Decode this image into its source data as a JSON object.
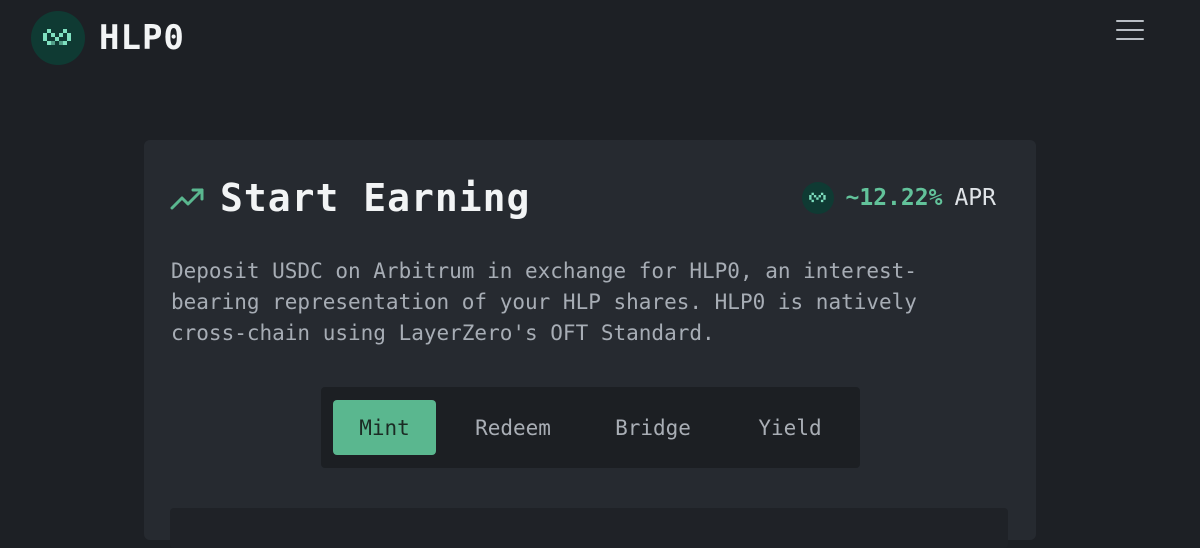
{
  "header": {
    "brand_name": "HLP0",
    "logo_icon": "hlp0-logo-icon",
    "menu_icon": "hamburger-menu-icon"
  },
  "card": {
    "title": "Start Earning",
    "title_icon": "trending-up-icon",
    "apr": {
      "value": "~12.22%",
      "label": "APR",
      "icon": "hlp0-logo-icon"
    },
    "description": "Deposit USDC on Arbitrum in exchange for HLP0, an interest-bearing representation of your HLP shares. HLP0 is natively cross-chain using LayerZero's OFT Standard.",
    "tabs": [
      {
        "label": "Mint",
        "active": true
      },
      {
        "label": "Redeem",
        "active": false
      },
      {
        "label": "Bridge",
        "active": false
      },
      {
        "label": "Yield",
        "active": false
      }
    ]
  },
  "colors": {
    "background": "#1d2025",
    "card": "#262a30",
    "accent": "#5ab78f",
    "apr_text": "#62c29a",
    "logo_bg": "#0f3a33"
  }
}
